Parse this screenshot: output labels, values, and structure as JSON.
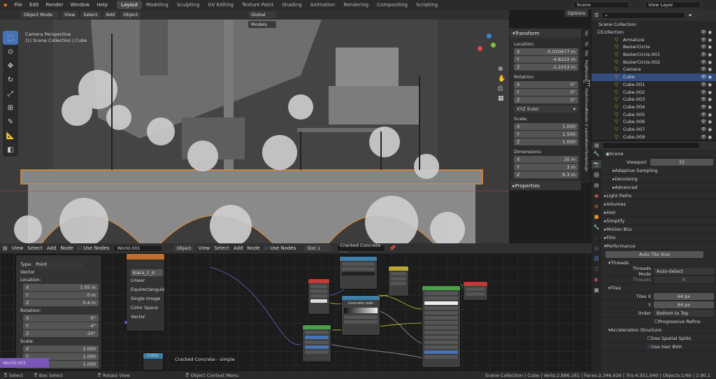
{
  "menubar": {
    "items": [
      "File",
      "Edit",
      "Render",
      "Window",
      "Help"
    ],
    "workspaces": [
      "Layout",
      "Modeling",
      "Sculpting",
      "UV Editing",
      "Texture Paint",
      "Shading",
      "Animation",
      "Rendering",
      "Compositing",
      "Scripting"
    ],
    "active_workspace": "Layout",
    "scene": "Scene",
    "view_layer": "View Layer"
  },
  "viewport": {
    "mode": "Object Mode",
    "menus": [
      "View",
      "Select",
      "Add",
      "Object"
    ],
    "orientation": "Global",
    "snap": "Models",
    "options": "Options",
    "camera_title": "Camera Perspective",
    "object_label": "(1) Scene Collection | Cube"
  },
  "npanel": {
    "transform": "Transform",
    "location": "Location:",
    "loc": [
      [
        "X",
        "-0.010677 m"
      ],
      [
        "Y",
        "-4.8222 m"
      ],
      [
        "Z",
        "-1.1013 m"
      ]
    ],
    "rotation": "Rotation:",
    "rot": [
      [
        "X",
        "0°"
      ],
      [
        "Y",
        "0°"
      ],
      [
        "Z",
        "0°"
      ]
    ],
    "rot_mode": "XYZ Euler",
    "scale": "Scale:",
    "sca": [
      [
        "X",
        "1.000"
      ],
      [
        "Y",
        "1.500"
      ],
      [
        "Z",
        "1.000"
      ]
    ],
    "dimensions": "Dimensions:",
    "dim": [
      [
        "X",
        "20 m"
      ],
      [
        "Y",
        "3 m"
      ],
      [
        "Z",
        "6.3 m"
      ]
    ],
    "properties": "Properties",
    "tabs": [
      "Ite",
      "To",
      "Vie",
      "Pag",
      "BlenDe",
      "BTT G",
      "Sketch",
      "Creat",
      "Blende",
      "Z",
      "pipero",
      "Bake",
      "Hard",
      "polygo"
    ]
  },
  "outliner": {
    "root": "Scene Collection",
    "collection": "Collection",
    "items": [
      {
        "name": "Armature",
        "sel": false
      },
      {
        "name": "BezierCircle",
        "sel": false
      },
      {
        "name": "BezierCircle.001",
        "sel": false
      },
      {
        "name": "BezierCircle.002",
        "sel": false
      },
      {
        "name": "Camera",
        "sel": false
      },
      {
        "name": "Cube",
        "sel": true
      },
      {
        "name": "Cube.001",
        "sel": false
      },
      {
        "name": "Cube.002",
        "sel": false
      },
      {
        "name": "Cube.003",
        "sel": false
      },
      {
        "name": "Cube.004",
        "sel": false
      },
      {
        "name": "Cube.005",
        "sel": false
      },
      {
        "name": "Cube.006",
        "sel": false
      },
      {
        "name": "Cube.007",
        "sel": false
      },
      {
        "name": "Cube.009",
        "sel": false
      }
    ]
  },
  "properties": {
    "scene": "Scene",
    "viewport_label": "Viewport",
    "viewport_val": "32",
    "sections": [
      "Adaptive Sampling",
      "Denoising",
      "Advanced",
      "Light Paths",
      "Volumes",
      "Hair",
      "Simplify",
      "Motion Blur",
      "Film",
      "Performance"
    ],
    "auto_tile": "Auto Tile Size",
    "threads": "Threads",
    "threads_mode_lbl": "Threads Mode",
    "threads_mode": "Auto-detect",
    "threads_lbl": "Threads",
    "threads_val": "8",
    "tiles": "Tiles",
    "tiles_x_lbl": "Tiles X",
    "tiles_x": "64 px",
    "tiles_y_lbl": "Y",
    "tiles_y": "64 px",
    "order_lbl": "Order",
    "order": "Bottom to Top",
    "progressive": "Progressive Refine",
    "accel": "Acceleration Structure",
    "spatial": "Use Spatial Splits",
    "hair_bvh": "Use Hair BVH"
  },
  "node_editor": {
    "left_menus": [
      "View",
      "Select",
      "Add",
      "Node"
    ],
    "use_nodes": "Use Nodes",
    "world": "World.001",
    "object": "Object",
    "right_menus": [
      "View",
      "Select",
      "Add",
      "Node"
    ],
    "slot": "Slot 1",
    "material": "Cracked Concrete - ...",
    "vec_type_lbl": "Type:",
    "vec_type": "Point",
    "vector": "Vector",
    "location": "Location:",
    "loc": [
      [
        "X",
        "1.05 m"
      ],
      [
        "Y",
        "0 m"
      ],
      [
        "Z",
        "0.4 m"
      ]
    ],
    "rotation": "Rotation:",
    "rot": [
      [
        "X",
        "0°"
      ],
      [
        "Y",
        "-4°"
      ],
      [
        "Z",
        "-20°"
      ]
    ],
    "scale": "Scale:",
    "sca": [
      [
        "X",
        "1.000"
      ],
      [
        "Y",
        "1.000"
      ],
      [
        "Z",
        "1.000"
      ]
    ],
    "env_opts": [
      "Linear",
      "Equirectangular",
      "Single Image",
      "Color Space",
      "Vector"
    ],
    "env_title": "kiara_1_d",
    "world_bar": "World.001",
    "color_node": "Color",
    "frame_label": "Cracked Concrete - simple",
    "concrete_color": "Concrete color"
  },
  "status": {
    "select": "Select",
    "box_select": "Box Select",
    "rotate": "Rotate View",
    "context": "Object Context Menu",
    "stats": "Scene Collection | Cube | Verts:2,886,161 | Faces:2,346,626 | Tris:4,551,940 | Objects:1/60 | 2.90.1"
  }
}
